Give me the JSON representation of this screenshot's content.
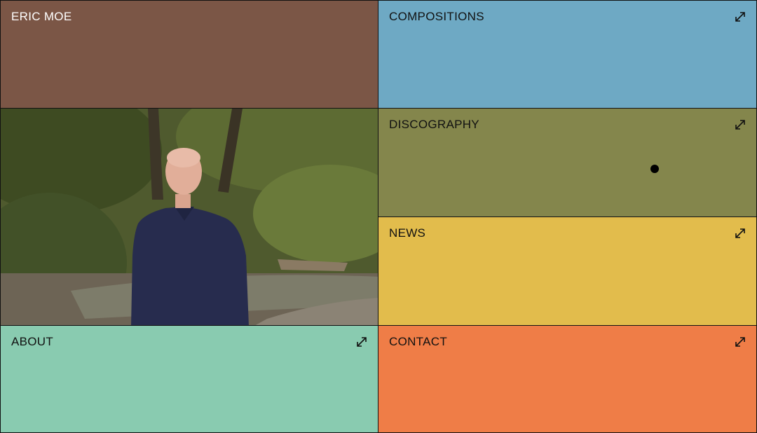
{
  "site": {
    "name": "ERIC MOE"
  },
  "nav": {
    "compositions": "COMPOSITIONS",
    "discography": "DISCOGRAPHY",
    "news": "NEWS",
    "about": "ABOUT",
    "contact": "CONTACT"
  },
  "colors": {
    "name_tile": "#7b5646",
    "compositions": "#6ea9c4",
    "discography": "#84864c",
    "news": "#e2bc4c",
    "about": "#89cbb0",
    "contact": "#ef7d47"
  },
  "icons": {
    "external": "arrow-expand-icon"
  }
}
